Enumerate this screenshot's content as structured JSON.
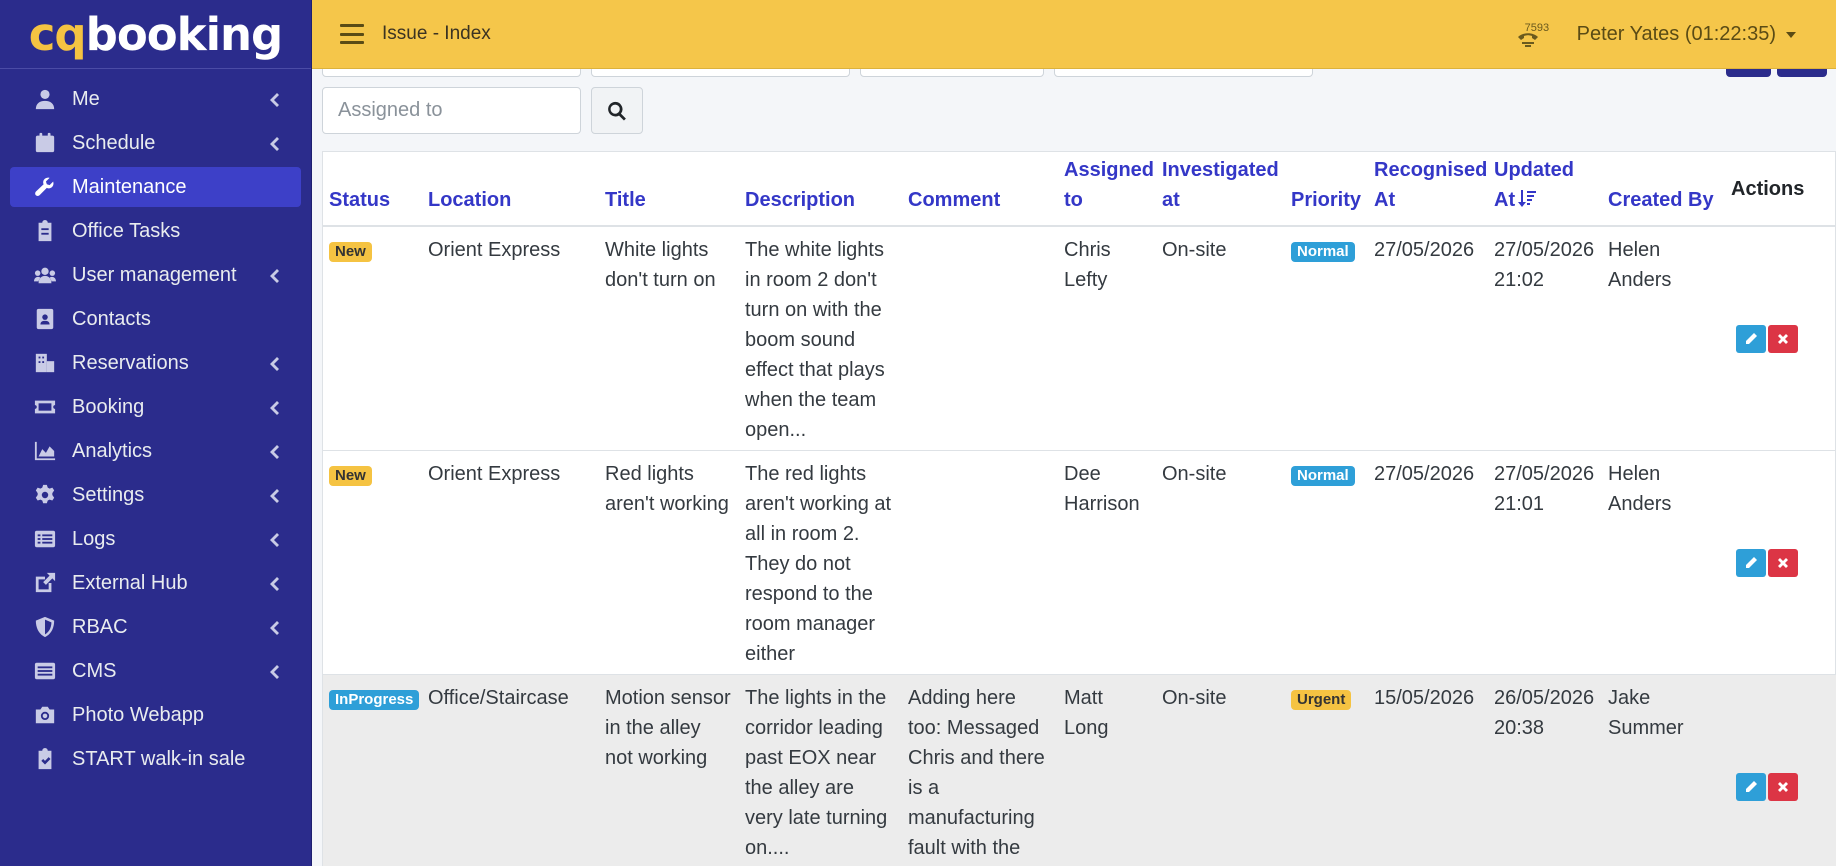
{
  "brand": {
    "logo_cq": "cq",
    "logo_rest": "booking"
  },
  "sidebar": {
    "items": [
      {
        "label": "Me",
        "icon": "user-icon",
        "has_submenu": true
      },
      {
        "label": "Schedule",
        "icon": "calendar-icon",
        "has_submenu": true
      },
      {
        "label": "Maintenance",
        "icon": "wrench-icon",
        "has_submenu": false,
        "active": true
      },
      {
        "label": "Office Tasks",
        "icon": "clipboard-icon",
        "has_submenu": false
      },
      {
        "label": "User management",
        "icon": "users-icon",
        "has_submenu": true
      },
      {
        "label": "Contacts",
        "icon": "address-book-icon",
        "has_submenu": false
      },
      {
        "label": "Reservations",
        "icon": "building-icon",
        "has_submenu": true
      },
      {
        "label": "Booking",
        "icon": "ticket-icon",
        "has_submenu": true
      },
      {
        "label": "Analytics",
        "icon": "area-chart-icon",
        "has_submenu": true
      },
      {
        "label": "Settings",
        "icon": "gear-icon",
        "has_submenu": true
      },
      {
        "label": "Logs",
        "icon": "list-icon",
        "has_submenu": true
      },
      {
        "label": "External Hub",
        "icon": "external-link-icon",
        "has_submenu": true
      },
      {
        "label": "RBAC",
        "icon": "shield-icon",
        "has_submenu": true
      },
      {
        "label": "CMS",
        "icon": "rectangle-list-icon",
        "has_submenu": true
      },
      {
        "label": "Photo Webapp",
        "icon": "camera-icon",
        "has_submenu": false
      },
      {
        "label": "START walk-in sale",
        "icon": "clipboard-check-icon",
        "has_submenu": false
      }
    ]
  },
  "header": {
    "title": "Issue - Index",
    "counter": "7593",
    "user": "Peter Yates (01:22:35)"
  },
  "filters": {
    "assigned_placeholder": "Assigned to"
  },
  "table": {
    "columns": {
      "status": "Status",
      "location": "Location",
      "title": "Title",
      "description": "Description",
      "comment": "Comment",
      "assigned": "Assigned to",
      "investigated": "Investigated at",
      "priority": "Priority",
      "recognised": "Recognised At",
      "updated": "Updated At",
      "created": "Created By",
      "actions": "Actions"
    },
    "rows": [
      {
        "status": "New",
        "location": "Orient Express",
        "title": "White lights don't turn on",
        "description": "The white lights in room 2 don't turn on with the boom sound effect that plays when the team open...",
        "comment": "",
        "assigned": "Chris Lefty",
        "investigated": "On-site",
        "priority": "Normal",
        "recognised": "27/05/2026",
        "updated": "27/05/2026 21:02",
        "created": "Helen Anders"
      },
      {
        "status": "New",
        "location": "Orient Express",
        "title": "Red lights aren't working",
        "description": "The red lights aren't working at all in room 2. They do not respond to the room manager either",
        "comment": "",
        "assigned": "Dee Harrison",
        "investigated": "On-site",
        "priority": "Normal",
        "recognised": "27/05/2026",
        "updated": "27/05/2026 21:01",
        "created": "Helen Anders"
      },
      {
        "status": "InProgress",
        "location": "Office/Staircase",
        "title": "Motion sensor in the alley not working",
        "description": "The lights in the corridor leading past EOX near the alley are very late turning on....",
        "comment": "Adding here too: Messaged Chris and there is a manufacturing fault with the",
        "assigned": "Matt Long",
        "investigated": "On-site",
        "priority": "Urgent",
        "recognised": "15/05/2026",
        "updated": "26/05/2026 20:38",
        "created": "Jake Summer"
      }
    ]
  },
  "colors": {
    "sidebar_bg": "#2b2c8c",
    "header_bg": "#f5c64a",
    "link_header": "#3437c7",
    "badge_yellow": "#f5c342",
    "badge_blue": "#2e9fd8",
    "delete_red": "#dc3545"
  }
}
